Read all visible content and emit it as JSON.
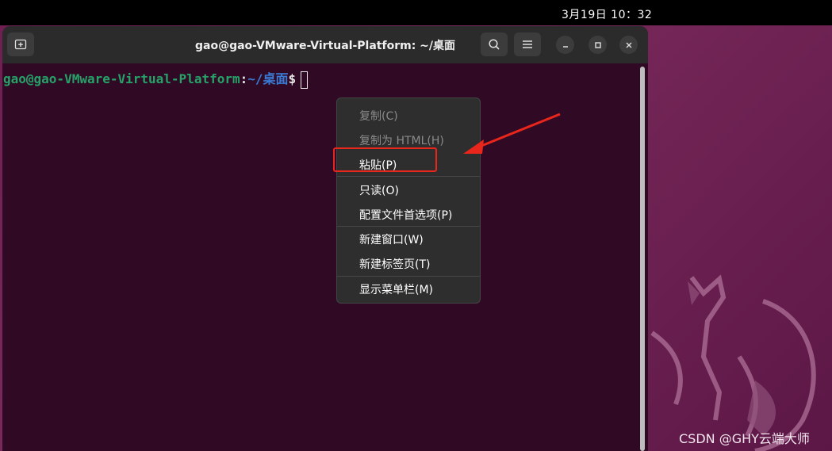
{
  "topbar": {
    "clock": "3月19日  10：32"
  },
  "window": {
    "title": "gao@gao-VMware-Virtual-Platform: ~/桌面",
    "buttons": {
      "new_tab_icon": "new-tab-icon",
      "search_icon": "search-icon",
      "menu_icon": "hamburger-menu-icon",
      "minimize_icon": "minimize-icon",
      "maximize_icon": "maximize-icon",
      "close_icon": "close-icon"
    }
  },
  "terminal": {
    "prompt_user": "gao@gao-VMware-Virtual-Platform",
    "prompt_colon": ":",
    "prompt_path": "~/桌面",
    "prompt_symbol": "$"
  },
  "context_menu": {
    "items": [
      {
        "label": "复制(C)",
        "enabled": false
      },
      {
        "label": "复制为 HTML(H)",
        "enabled": false
      },
      {
        "label": "粘贴(P)",
        "enabled": true
      },
      {
        "label": "只读(O)",
        "enabled": true
      },
      {
        "label": "配置文件首选项(P)",
        "enabled": true
      },
      {
        "label": "新建窗口(W)",
        "enabled": true
      },
      {
        "label": "新建标签页(T)",
        "enabled": true
      },
      {
        "label": "显示菜单栏(M)",
        "enabled": true
      }
    ]
  },
  "annotation": {
    "highlight_color": "#e8261b"
  },
  "watermark": "CSDN @GHY云端大师",
  "colors": {
    "terminal_bg": "#300a24",
    "titlebar_bg": "#2b2b2b",
    "prompt_user": "#26a269",
    "prompt_path": "#3a7bd5"
  }
}
